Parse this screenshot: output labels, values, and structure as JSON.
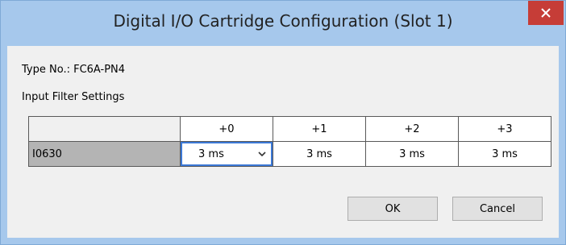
{
  "window": {
    "title": "Digital I/O Cartridge Configuration (Slot 1)",
    "close_symbol": "✕"
  },
  "info": {
    "type_no": "Type No.: FC6A-PN4",
    "section": "Input Filter Settings"
  },
  "table": {
    "columns": [
      "+0",
      "+1",
      "+2",
      "+3"
    ],
    "rows": [
      {
        "address": "I0630",
        "values": [
          "3 ms",
          "3 ms",
          "3 ms",
          "3 ms"
        ]
      }
    ]
  },
  "buttons": {
    "ok": "OK",
    "cancel": "Cancel"
  },
  "colors": {
    "titlebar": "#a6c8ec",
    "close": "#c63d37",
    "selected_outline": "#3b78d6"
  },
  "icons": {
    "close": "close-icon",
    "dropdown": "chevron-down-icon"
  }
}
